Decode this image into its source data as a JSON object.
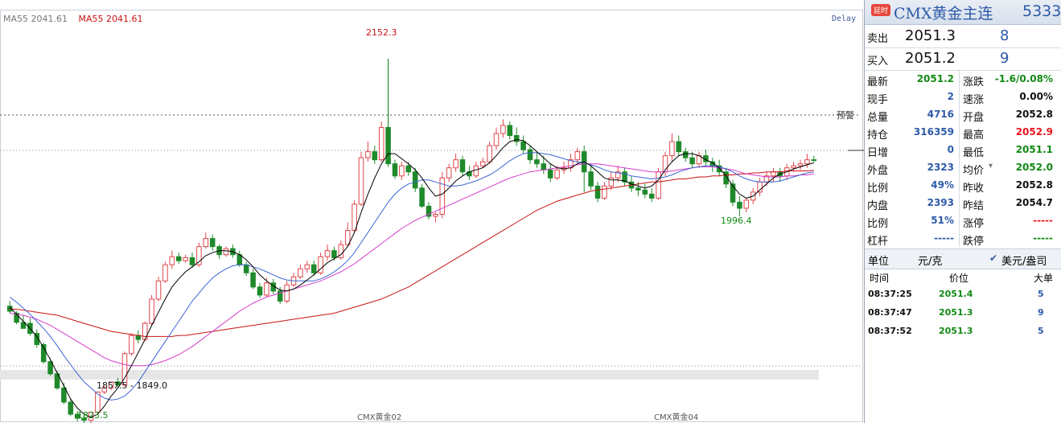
{
  "legend": {
    "ma_short": "MA55 2041.61",
    "ma_long": "MA55 2041.61",
    "delay": "Delay",
    "alert": "预警"
  },
  "annotations": {
    "high": "2152.3",
    "low": "1823.5",
    "range": "1857.5 - 1849.0",
    "mid_low": "1996.4"
  },
  "x_labels": [
    "CMX黄金02",
    "CMX黄金04"
  ],
  "colors": {
    "up": "#e0464b",
    "down": "#1f8a2b",
    "ma5": "#000000",
    "ma10": "#3c64d4",
    "ma20": "#d63ccc",
    "ma55": "#c81414",
    "red_text": "#e8141e",
    "green_text": "#128a14",
    "blue_text": "#2d5aa8"
  },
  "chart_data": {
    "type": "candlestick",
    "ylim": [
      1812,
      2172
    ],
    "ohlc": [
      [
        1907,
        1912,
        1902,
        1900
      ],
      [
        1900,
        1902,
        1891,
        1889
      ],
      [
        1891,
        1898,
        1885,
        1890
      ],
      [
        1890,
        1895,
        1880,
        1878
      ],
      [
        1880,
        1884,
        1869,
        1866
      ],
      [
        1869,
        1871,
        1852,
        1850
      ],
      [
        1852,
        1856,
        1840,
        1838
      ],
      [
        1840,
        1843,
        1826,
        1824
      ],
      [
        1826,
        1831,
        1812,
        1810
      ],
      [
        1812,
        1815,
        1800,
        1798
      ],
      [
        1800,
        1803,
        1796,
        1793
      ],
      [
        1796,
        1800,
        1794,
        1791
      ],
      [
        1794,
        1797,
        1802,
        1787
      ],
      [
        1802,
        1806,
        1822,
        1800
      ],
      [
        1822,
        1828,
        1826,
        1820
      ],
      [
        1826,
        1830,
        1832,
        1824
      ],
      [
        1832,
        1836,
        1829,
        1826
      ],
      [
        1829,
        1862,
        1860,
        1827
      ],
      [
        1860,
        1880,
        1878,
        1858
      ],
      [
        1878,
        1883,
        1874,
        1870
      ],
      [
        1874,
        1892,
        1890,
        1872
      ],
      [
        1890,
        1918,
        1914,
        1888
      ],
      [
        1914,
        1936,
        1932,
        1912
      ],
      [
        1932,
        1951,
        1948,
        1930
      ],
      [
        1948,
        1962,
        1956,
        1944
      ],
      [
        1956,
        1960,
        1952,
        1949
      ],
      [
        1952,
        1958,
        1955,
        1950
      ],
      [
        1955,
        1960,
        1948,
        1945
      ],
      [
        1948,
        1970,
        1966,
        1946
      ],
      [
        1966,
        1980,
        1974,
        1964
      ],
      [
        1974,
        1978,
        1966,
        1962
      ],
      [
        1966,
        1968,
        1958,
        1954
      ],
      [
        1958,
        1966,
        1964,
        1956
      ],
      [
        1964,
        1968,
        1958,
        1955
      ],
      [
        1958,
        1962,
        1948,
        1946
      ],
      [
        1948,
        1951,
        1940,
        1937
      ],
      [
        1940,
        1944,
        1926,
        1924
      ],
      [
        1926,
        1930,
        1918,
        1915
      ],
      [
        1918,
        1935,
        1930,
        1916
      ],
      [
        1930,
        1934,
        1922,
        1919
      ],
      [
        1922,
        1926,
        1912,
        1909
      ],
      [
        1912,
        1932,
        1928,
        1910
      ],
      [
        1928,
        1940,
        1936,
        1926
      ],
      [
        1936,
        1948,
        1944,
        1934
      ],
      [
        1944,
        1952,
        1948,
        1940
      ],
      [
        1948,
        1952,
        1940,
        1937
      ],
      [
        1940,
        1960,
        1956,
        1938
      ],
      [
        1956,
        1968,
        1962,
        1952
      ],
      [
        1962,
        1966,
        1955,
        1952
      ],
      [
        1955,
        1972,
        1968,
        1953
      ],
      [
        1968,
        1990,
        1982,
        1966
      ],
      [
        1982,
        2012,
        2008,
        1980
      ],
      [
        2008,
        2060,
        2054,
        2006
      ],
      [
        2054,
        2070,
        2060,
        2050
      ],
      [
        2060,
        2066,
        2052,
        2048
      ],
      [
        2052,
        2090,
        2084,
        2050
      ],
      [
        2084,
        2152,
        2048,
        2045
      ],
      [
        2048,
        2052,
        2036,
        2033
      ],
      [
        2036,
        2050,
        2046,
        2032
      ],
      [
        2046,
        2050,
        2040,
        2036
      ],
      [
        2040,
        2044,
        2024,
        2020
      ],
      [
        2024,
        2028,
        2006,
        2004
      ],
      [
        2006,
        2010,
        1996,
        1993
      ],
      [
        1996,
        2000,
        1998,
        1990
      ],
      [
        1998,
        2040,
        2034,
        1994
      ],
      [
        2034,
        2048,
        2044,
        2030
      ],
      [
        2044,
        2058,
        2052,
        2040
      ],
      [
        2052,
        2056,
        2040,
        2036
      ],
      [
        2040,
        2046,
        2036,
        2032
      ],
      [
        2036,
        2050,
        2046,
        2034
      ],
      [
        2046,
        2054,
        2050,
        2044
      ],
      [
        2050,
        2070,
        2066,
        2048
      ],
      [
        2066,
        2084,
        2078,
        2062
      ],
      [
        2078,
        2092,
        2086,
        2074
      ],
      [
        2086,
        2090,
        2076,
        2072
      ],
      [
        2076,
        2084,
        2070,
        2066
      ],
      [
        2070,
        2076,
        2062,
        2058
      ],
      [
        2062,
        2066,
        2052,
        2048
      ],
      [
        2052,
        2060,
        2048,
        2044
      ],
      [
        2048,
        2056,
        2042,
        2038
      ],
      [
        2042,
        2048,
        2034,
        2030
      ],
      [
        2034,
        2046,
        2042,
        2032
      ],
      [
        2042,
        2050,
        2044,
        2038
      ],
      [
        2044,
        2058,
        2052,
        2040
      ],
      [
        2052,
        2064,
        2060,
        2048
      ],
      [
        2060,
        2066,
        2040,
        2020
      ],
      [
        2040,
        2046,
        2026,
        2022
      ],
      [
        2026,
        2030,
        2014,
        2010
      ],
      [
        2014,
        2030,
        2026,
        2012
      ],
      [
        2026,
        2040,
        2034,
        2022
      ],
      [
        2034,
        2046,
        2040,
        2030
      ],
      [
        2040,
        2044,
        2030,
        2026
      ],
      [
        2030,
        2036,
        2024,
        2020
      ],
      [
        2024,
        2030,
        2022,
        2016
      ],
      [
        2022,
        2028,
        2018,
        2014
      ],
      [
        2018,
        2024,
        2014,
        2010
      ],
      [
        2014,
        2044,
        2040,
        2012
      ],
      [
        2040,
        2060,
        2056,
        2036
      ],
      [
        2056,
        2078,
        2070,
        2050
      ],
      [
        2070,
        2076,
        2060,
        2056
      ],
      [
        2060,
        2064,
        2054,
        2050
      ],
      [
        2054,
        2060,
        2048,
        2044
      ],
      [
        2048,
        2060,
        2056,
        2044
      ],
      [
        2056,
        2062,
        2050,
        2046
      ],
      [
        2050,
        2054,
        2046,
        2040
      ],
      [
        2046,
        2052,
        2040,
        2036
      ],
      [
        2040,
        2044,
        2028,
        2024
      ],
      [
        2028,
        2032,
        2010,
        2006
      ],
      [
        2010,
        2016,
        2004,
        1996
      ],
      [
        2004,
        2014,
        2012,
        2000
      ],
      [
        2012,
        2024,
        2020,
        2008
      ],
      [
        2020,
        2034,
        2030,
        2016
      ],
      [
        2030,
        2040,
        2036,
        2026
      ],
      [
        2036,
        2044,
        2040,
        2030
      ],
      [
        2040,
        2044,
        2036,
        2030
      ],
      [
        2036,
        2048,
        2044,
        2032
      ],
      [
        2044,
        2050,
        2046,
        2040
      ],
      [
        2046,
        2052,
        2048,
        2042
      ],
      [
        2048,
        2058,
        2052,
        2044
      ],
      [
        2052,
        2056,
        2051.2,
        2050
      ]
    ],
    "ma5": [
      1906,
      1899,
      1892,
      1885,
      1877,
      1866,
      1854,
      1841,
      1828,
      1815,
      1806,
      1800,
      1797,
      1800,
      1808,
      1818,
      1826,
      1836,
      1848,
      1861,
      1874,
      1888,
      1901,
      1914,
      1926,
      1934,
      1941,
      1946,
      1951,
      1957,
      1960,
      1962,
      1962,
      1961,
      1958,
      1953,
      1946,
      1938,
      1932,
      1927,
      1923,
      1922,
      1924,
      1928,
      1933,
      1938,
      1944,
      1950,
      1954,
      1958,
      1966,
      1980,
      2000,
      2018,
      2034,
      2048,
      2058,
      2058,
      2053,
      2048,
      2042,
      2034,
      2024,
      2016,
      2018,
      2024,
      2031,
      2036,
      2040,
      2042,
      2044,
      2049,
      2056,
      2064,
      2070,
      2072,
      2071,
      2066,
      2060,
      2054,
      2048,
      2044,
      2043,
      2044,
      2048,
      2050,
      2046,
      2040,
      2034,
      2032,
      2032,
      2031,
      2028,
      2026,
      2024,
      2026,
      2032,
      2042,
      2050,
      2056,
      2058,
      2058,
      2056,
      2052,
      2049,
      2044,
      2036,
      2026,
      2018,
      2014,
      2016,
      2022,
      2028,
      2034,
      2038,
      2040,
      2043,
      2045,
      2047,
      2049
    ],
    "ma10": [
      1916,
      1911,
      1905,
      1899,
      1892,
      1885,
      1877,
      1868,
      1858,
      1849,
      1840,
      1832,
      1826,
      1820,
      1816,
      1814,
      1815,
      1818,
      1824,
      1832,
      1842,
      1852,
      1862,
      1872,
      1882,
      1892,
      1902,
      1912,
      1920,
      1928,
      1935,
      1940,
      1944,
      1947,
      1948,
      1948,
      1946,
      1944,
      1941,
      1938,
      1935,
      1933,
      1932,
      1932,
      1932,
      1932,
      1934,
      1937,
      1941,
      1946,
      1952,
      1960,
      1970,
      1980,
      1990,
      2000,
      2010,
      2018,
      2024,
      2028,
      2030,
      2032,
      2032,
      2030,
      2028,
      2026,
      2026,
      2027,
      2029,
      2031,
      2034,
      2037,
      2041,
      2046,
      2051,
      2055,
      2058,
      2059,
      2059,
      2058,
      2057,
      2055,
      2053,
      2051,
      2050,
      2049,
      2047,
      2045,
      2042,
      2040,
      2039,
      2038,
      2036,
      2035,
      2034,
      2033,
      2034,
      2035,
      2037,
      2040,
      2042,
      2044,
      2045,
      2046,
      2046,
      2045,
      2043,
      2040,
      2036,
      2033,
      2031,
      2030,
      2030,
      2030,
      2031,
      2033,
      2035,
      2037,
      2039,
      2040
    ],
    "ma20": [
      1900,
      1899,
      1898,
      1896,
      1894,
      1891,
      1888,
      1884,
      1880,
      1876,
      1872,
      1868,
      1864,
      1860,
      1856,
      1853,
      1851,
      1849,
      1848,
      1848,
      1848,
      1849,
      1851,
      1853,
      1856,
      1859,
      1863,
      1867,
      1872,
      1877,
      1882,
      1887,
      1892,
      1897,
      1902,
      1906,
      1910,
      1913,
      1916,
      1918,
      1920,
      1922,
      1924,
      1926,
      1928,
      1930,
      1932,
      1935,
      1938,
      1941,
      1945,
      1949,
      1954,
      1959,
      1964,
      1969,
      1974,
      1979,
      1984,
      1988,
      1992,
      1995,
      1998,
      2001,
      2004,
      2007,
      2010,
      2013,
      2016,
      2019,
      2022,
      2025,
      2028,
      2031,
      2034,
      2036,
      2038,
      2040,
      2041,
      2042,
      2043,
      2044,
      2045,
      2046,
      2047,
      2048,
      2048,
      2048,
      2047,
      2046,
      2045,
      2044,
      2043,
      2042,
      2041,
      2040,
      2040,
      2040,
      2041,
      2042,
      2043,
      2044,
      2045,
      2045,
      2045,
      2044,
      2043,
      2042,
      2040,
      2038,
      2037,
      2036,
      2035,
      2035,
      2035,
      2036,
      2036,
      2037,
      2037,
      2038
    ],
    "ma55": [
      1904,
      1904,
      1903,
      1902,
      1901,
      1900,
      1899,
      1898,
      1896,
      1894,
      1892,
      1890,
      1888,
      1886,
      1884,
      1882,
      1881,
      1880,
      1879,
      1878,
      1877,
      1877,
      1877,
      1877,
      1877,
      1878,
      1878,
      1879,
      1880,
      1881,
      1882,
      1883,
      1884,
      1885,
      1886,
      1887,
      1888,
      1889,
      1890,
      1891,
      1892,
      1893,
      1894,
      1895,
      1896,
      1897,
      1898,
      1899,
      1900,
      1902,
      1904,
      1906,
      1908,
      1910,
      1912,
      1914,
      1917,
      1920,
      1923,
      1926,
      1930,
      1934,
      1938,
      1942,
      1946,
      1950,
      1954,
      1958,
      1962,
      1966,
      1970,
      1974,
      1978,
      1982,
      1986,
      1990,
      1994,
      1998,
      2002,
      2005,
      2008,
      2011,
      2013,
      2015,
      2017,
      2019,
      2021,
      2022,
      2023,
      2024,
      2025,
      2026,
      2027,
      2028,
      2029,
      2030,
      2030,
      2031,
      2032,
      2033,
      2033,
      2034,
      2035,
      2035,
      2036,
      2036,
      2037,
      2037,
      2038,
      2038,
      2039,
      2039,
      2040,
      2040,
      2040,
      2041,
      2041,
      2041,
      2041,
      2041.61
    ],
    "alert_level": 2098,
    "prev_settle_level": 2054.7
  },
  "panel": {
    "delay_badge": "延时",
    "symbol": "CMX黄金主连",
    "code": "5333",
    "ask_label": "卖出",
    "ask_price": "2051.3",
    "ask_vol": "8",
    "bid_label": "买入",
    "bid_price": "2051.2",
    "bid_vol": "9",
    "quotes_left": [
      {
        "label": "最新",
        "value": "2051.2",
        "color": "green"
      },
      {
        "label": "现手",
        "value": "2",
        "color": "blue"
      },
      {
        "label": "总量",
        "value": "4716",
        "color": "blue"
      },
      {
        "label": "持仓",
        "value": "316359",
        "color": "blue"
      },
      {
        "label": "日增",
        "value": "0",
        "color": "blue"
      },
      {
        "label": "外盘",
        "value": "2323",
        "color": "blue"
      },
      {
        "label": "比例",
        "value": "49%",
        "color": "blue"
      },
      {
        "label": "内盘",
        "value": "2393",
        "color": "blue"
      },
      {
        "label": "比例",
        "value": "51%",
        "color": "blue"
      },
      {
        "label": "杠杆",
        "value": "-----",
        "color": "blue"
      }
    ],
    "quotes_right": [
      {
        "label": "涨跌",
        "value": "-1.6/0.08%",
        "color": "green"
      },
      {
        "label": "速涨",
        "value": "0.00%",
        "color": "black"
      },
      {
        "label": "开盘",
        "value": "2052.8",
        "color": "black"
      },
      {
        "label": "最高",
        "value": "2052.9",
        "color": "red"
      },
      {
        "label": "最低",
        "value": "2051.1",
        "color": "green"
      },
      {
        "label": "均价",
        "value": "2052.0",
        "color": "green"
      },
      {
        "label": "昨收",
        "value": "2052.8",
        "color": "black"
      },
      {
        "label": "昨结",
        "value": "2054.7",
        "color": "black"
      },
      {
        "label": "涨停",
        "value": "-----",
        "color": "red"
      },
      {
        "label": "跌停",
        "value": "-----",
        "color": "green"
      }
    ],
    "unit_label": "单位",
    "unit_cny": "元/克",
    "unit_usd": "美元/盎司",
    "tick_headers": [
      "时间",
      "价位",
      "大单"
    ],
    "ticks": [
      {
        "time": "08:37:25",
        "price": "2051.4",
        "vol": "5"
      },
      {
        "time": "08:37:47",
        "price": "2051.3",
        "vol": "9"
      },
      {
        "time": "08:37:52",
        "price": "2051.3",
        "vol": "5"
      }
    ]
  }
}
